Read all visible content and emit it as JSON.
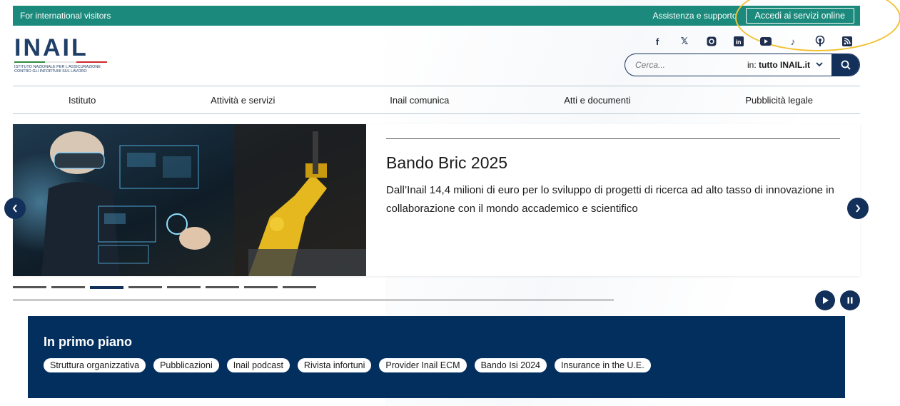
{
  "topbar": {
    "international": "For international visitors",
    "support": "Assistenza e supporto",
    "login": "Accedi ai servizi online"
  },
  "logo": {
    "mark": "INAIL",
    "subtitle_line1": "Istituto Nazionale per l'Assicurazione",
    "subtitle_line2": "contro gli Infortuni sul Lavoro"
  },
  "socials": [
    "facebook-icon",
    "x-icon",
    "instagram-icon",
    "linkedin-icon",
    "youtube-icon",
    "tiktok-icon",
    "podcast-icon",
    "rss-icon"
  ],
  "search": {
    "placeholder": "Cerca...",
    "scope_prefix": "in:",
    "scope_value": "tutto INAIL.it"
  },
  "nav": {
    "items": [
      "Istituto",
      "Attività e servizi",
      "Inail comunica",
      "Atti e documenti",
      "Pubblicità legale"
    ]
  },
  "hero": {
    "title": "Bando Bric 2025",
    "text": "Dall’Inail 14,4 milioni di euro per lo sviluppo di progetti di ricerca ad alto tasso di innovazione in collaborazione con il mondo accademico e scientifico",
    "slides": 8,
    "active_slide": 3
  },
  "primo": {
    "title": "In primo piano",
    "chips": [
      "Struttura organizzativa",
      "Pubblicazioni",
      "Inail podcast",
      "Rivista infortuni",
      "Provider Inail ECM",
      "Bando Isi 2024",
      "Insurance in the U.E."
    ]
  },
  "colors": {
    "topbar": "#1b8a7c",
    "navy": "#12305a",
    "primo_bg": "#022f5e",
    "highlight": "#f2c232"
  }
}
